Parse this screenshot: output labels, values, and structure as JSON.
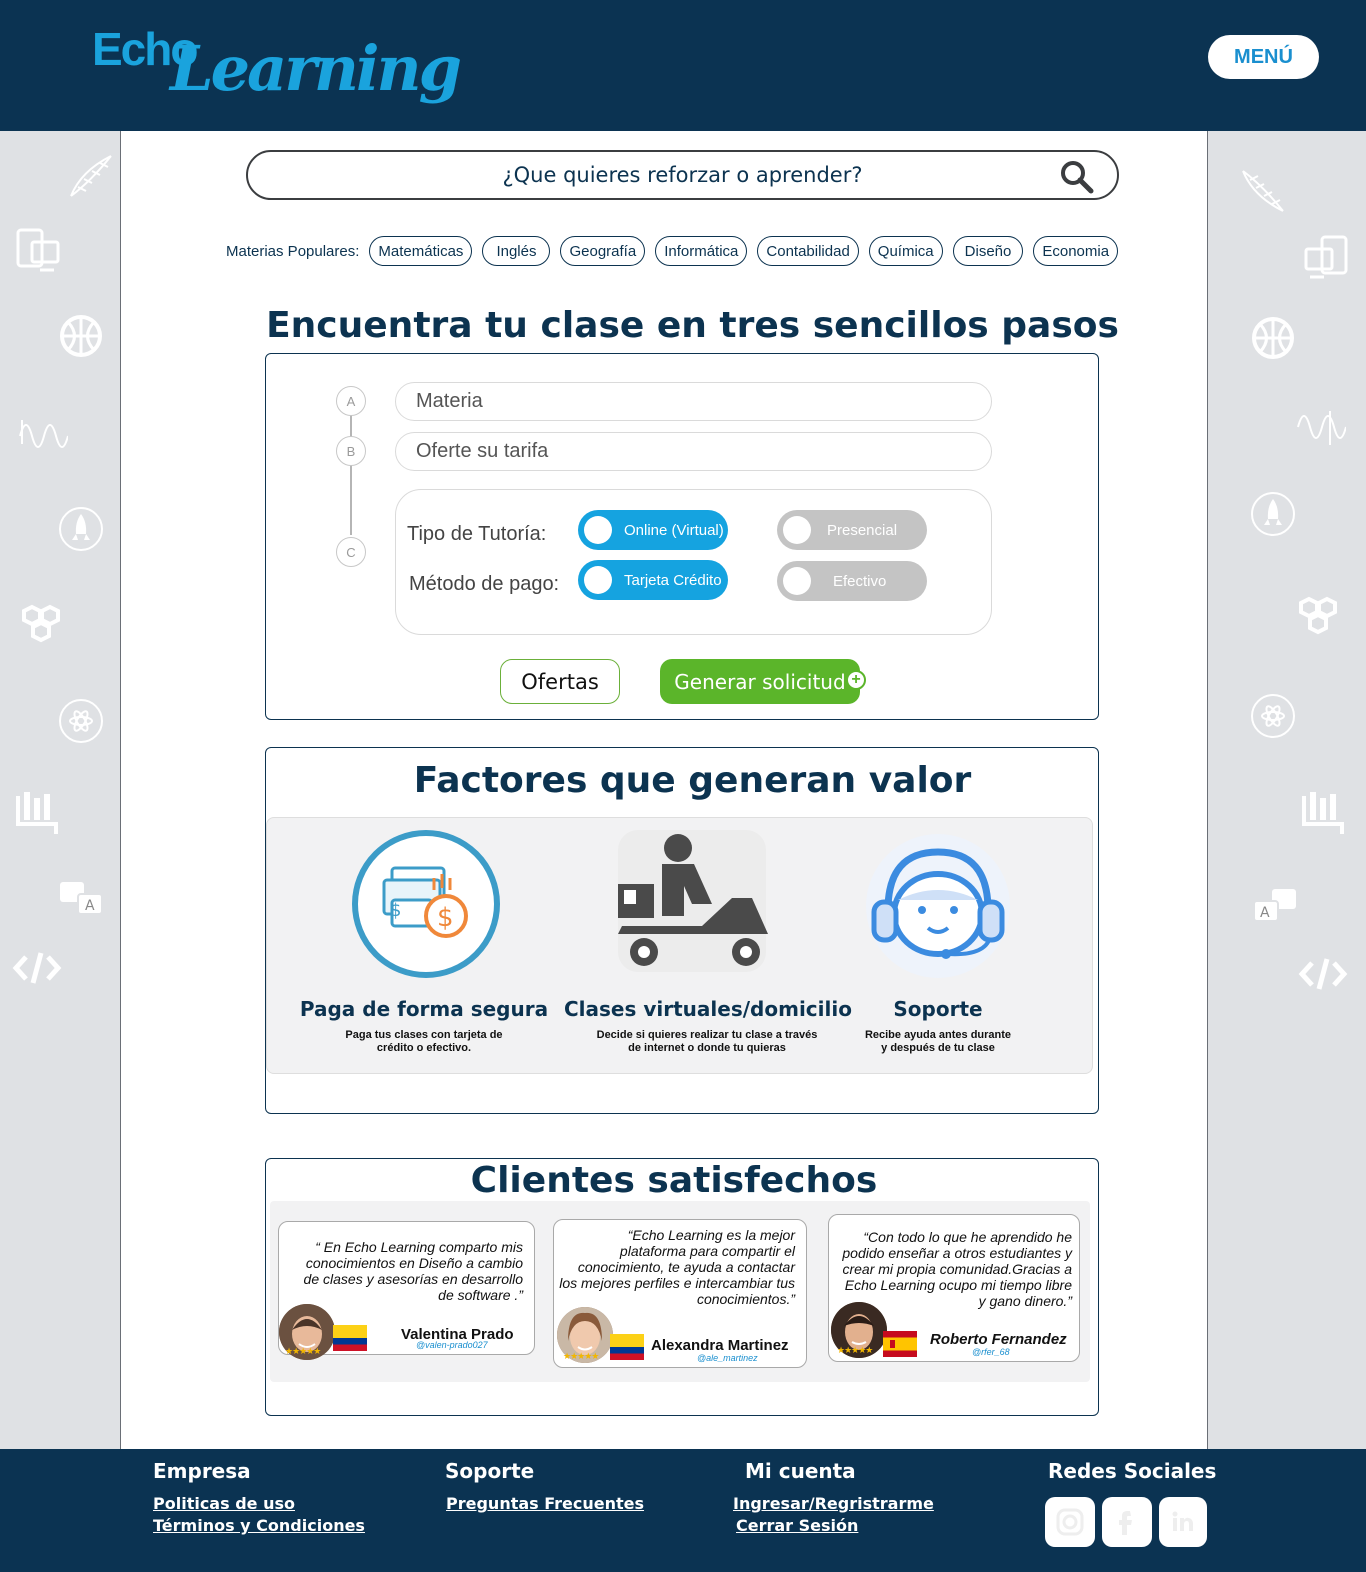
{
  "header": {
    "logo_echo": "Echo",
    "logo_learning": "Learning",
    "menu_label": "MENÚ"
  },
  "search": {
    "placeholder": "¿Que quieres reforzar o aprender?"
  },
  "popular": {
    "label": "Materias Populares:",
    "chips": [
      "Matemáticas",
      "Inglés",
      "Geografía",
      "Informática",
      "Contabilidad",
      "Química",
      "Diseño",
      "Economia"
    ]
  },
  "steps_section": {
    "title": "Encuentra tu clase en tres sencillos pasos",
    "markers": [
      "A",
      "B",
      "C"
    ],
    "materia_placeholder": "Materia",
    "tarifa_placeholder": "Oferte su tarifa",
    "tipo_label": "Tipo de Tutoría:",
    "pago_label": "Método de pago:",
    "online_label": "Online (Virtual)",
    "presencial_label": "Presencial",
    "tarjeta_label": "Tarjeta Crédito",
    "efectivo_label": "Efectivo",
    "ofertas_button": "Ofertas",
    "generar_button": "Generar solicitud"
  },
  "factors": {
    "title": "Factores que generan valor",
    "items": [
      {
        "title": "Paga de forma segura",
        "desc": "Paga tus clases con tarjeta de crédito o efectivo."
      },
      {
        "title": "Clases virtuales/domicilio",
        "desc": "Decide si quieres realizar tu clase a través de internet o donde tu quieras"
      },
      {
        "title": "Soporte",
        "desc": "Recibe ayuda antes durante y después de tu clase"
      }
    ]
  },
  "testimonials": {
    "title": "Clientes satisfechos",
    "items": [
      {
        "quote": "“ En Echo Learning comparto mis conocimientos en Diseño a cambio de clases y asesorías en desarrollo de software .”",
        "name": "Valentina Prado",
        "handle": "@valen-prado027",
        "stars": "★★★★★"
      },
      {
        "quote": "“Echo Learning es la mejor plataforma para compartir el conocimiento, te ayuda a contactar los mejores perfiles e intercambiar tus conocimientos.”",
        "name": "Alexandra Martinez",
        "handle": "@ale_martinez",
        "stars": "★★★★★"
      },
      {
        "quote": "“Con todo lo que he aprendido he podido enseñar a otros estudiantes y crear mi propia comunidad.Gracias a Echo Learning ocupo mi tiempo libre y gano dinero.”",
        "name": "Roberto Fernandez",
        "handle": "@rfer_68",
        "stars": "★★★★★"
      }
    ]
  },
  "footer": {
    "empresa": "Empresa",
    "politicas": "Politicas de uso",
    "terminos": "Términos y Condiciones",
    "soporte": "Soporte",
    "preguntas": "Preguntas Frecuentes",
    "micuenta": "Mi cuenta",
    "ingresar": "Ingresar/Regristrarme",
    "cerrar": "Cerrar Sesión",
    "redes": "Redes Sociales"
  },
  "colors": {
    "navy": "#0b3352",
    "accent_blue": "#15a3e0",
    "green": "#5bb52a",
    "side_gray": "#dfe1e4"
  }
}
